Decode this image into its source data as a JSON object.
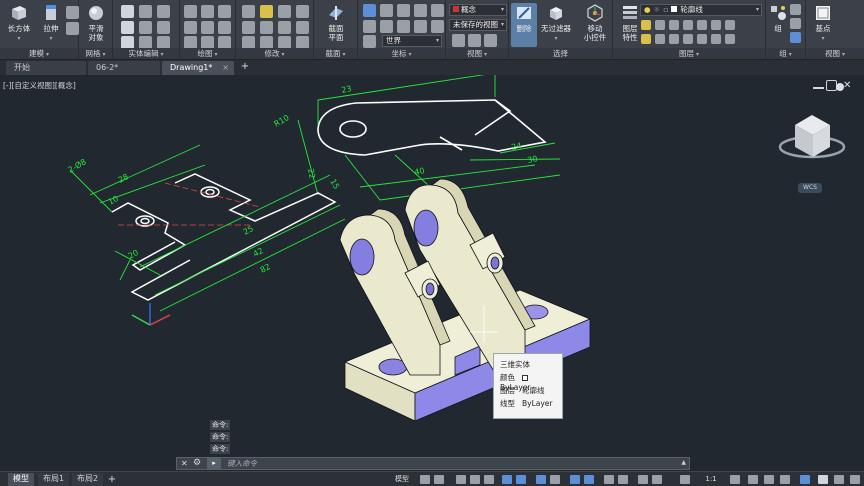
{
  "ribbon": {
    "panels": {
      "modeling": {
        "title": "建模",
        "box": "长方体",
        "extrude": "拉伸"
      },
      "mesh": {
        "title": "网格",
        "smooth": "平滑\n对象"
      },
      "solid_edit": {
        "title": "实体编辑"
      },
      "draw": {
        "title": "绘图"
      },
      "modify": {
        "title": "修改"
      },
      "section": {
        "title": "截面",
        "section_plane": "截面\n平面"
      },
      "coordinates": {
        "title": "坐标",
        "ucs_value": "世界"
      },
      "view": {
        "title": "视图",
        "visual_style": "概念",
        "saved_view": "未保存的视图"
      },
      "selection": {
        "title": "选择",
        "delete": "删除",
        "no_filter": "无过滤器",
        "gizmo": "移动\n小控件"
      },
      "layers": {
        "title": "图层",
        "layer_props": "图层\n特性",
        "layer_value": "轮廓线"
      },
      "groups": {
        "title": "组",
        "group": "组"
      },
      "view2": {
        "title": "视图",
        "base": "基点"
      }
    }
  },
  "doc_tabs": {
    "tabs": [
      "开始",
      "06-2*",
      "Drawing1*"
    ],
    "active": "Drawing1*"
  },
  "viewport": {
    "label": "[-][自定义视图][概念]",
    "wcs": "WCS"
  },
  "dimensions": {
    "ring_top": "23",
    "ring_radius": "R10",
    "ring_r7": "R7",
    "ring_24": "24",
    "ring_30": "30",
    "ring_22": "22",
    "ring_40": "40",
    "ring_15": "15",
    "plate_80": "2-Ø8",
    "plate_28": "28",
    "plate_10": "10",
    "plate_20": "20",
    "plate_42": "42",
    "plate_12": "12",
    "plate_25": "25",
    "plate_40": "40",
    "plate_82": "82"
  },
  "tooltip": {
    "title": "三维实体",
    "rows": [
      {
        "key": "颜色",
        "value": "ByLayer"
      },
      {
        "key": "图层",
        "value": "轮廓线"
      },
      {
        "key": "线型",
        "value": "ByLayer"
      }
    ]
  },
  "command_history": [
    "命令:",
    "命令:",
    "命令:"
  ],
  "command_line": {
    "placeholder": "键入命令"
  },
  "status_bar": {
    "layout_tabs": [
      "模型",
      "布局1",
      "布局2"
    ],
    "model": "模型",
    "scale": "1:1"
  },
  "colors": {
    "background": "#212830",
    "dimension": "#27e63a",
    "solid_face": "#eae9d0",
    "solid_shadow": "#8b85e6"
  }
}
